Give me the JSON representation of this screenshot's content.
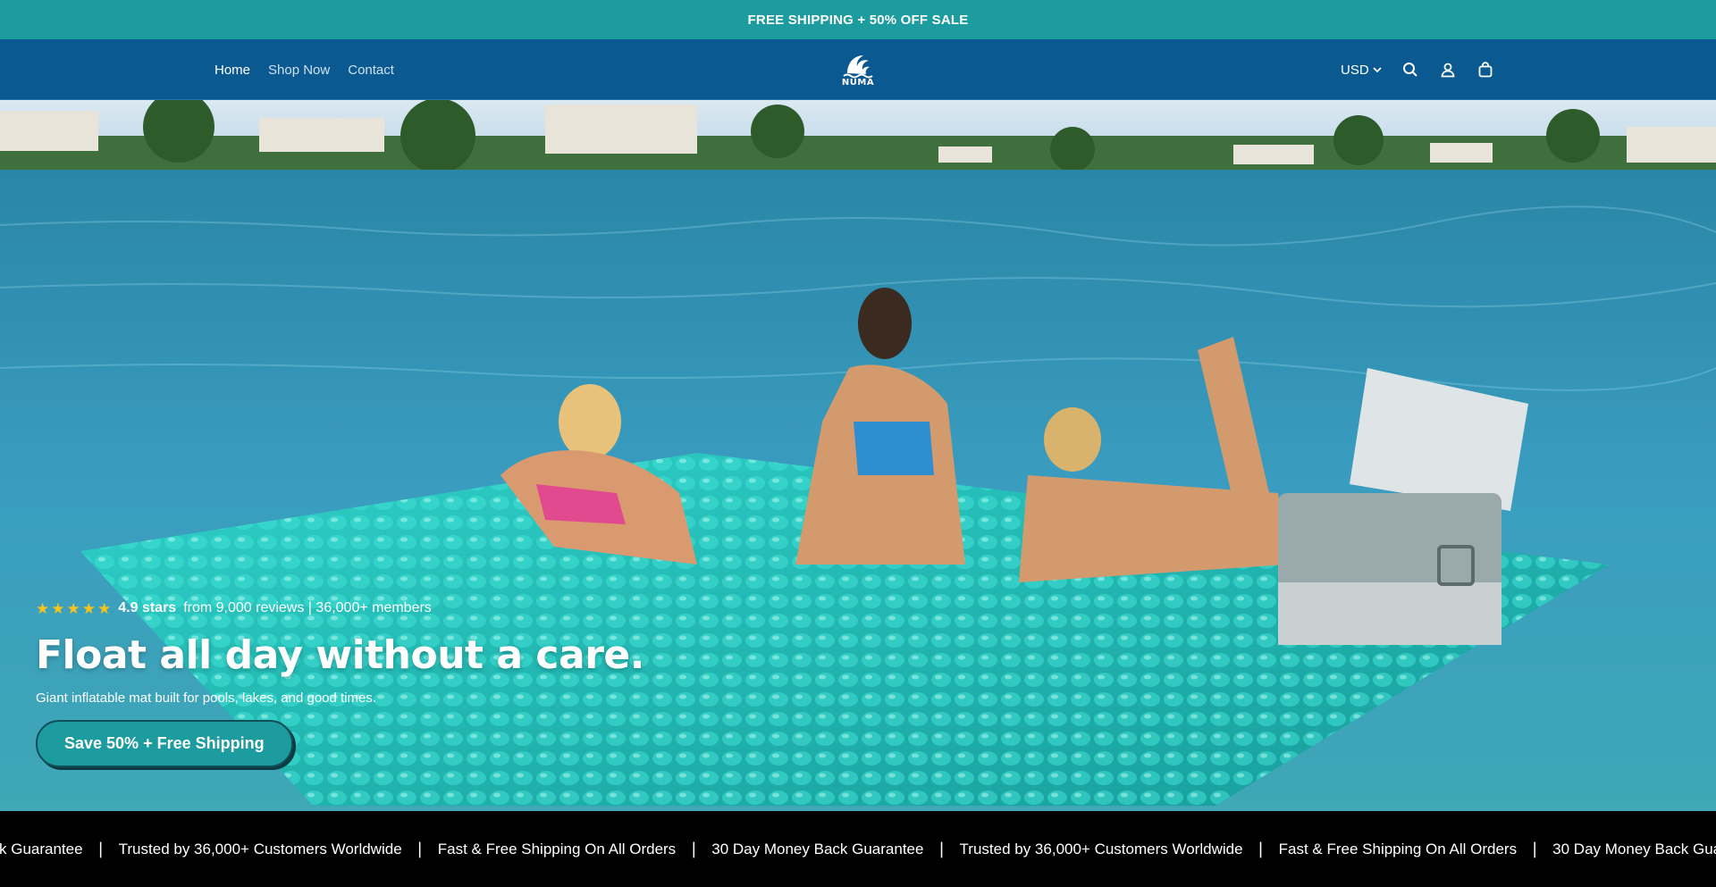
{
  "announcement": {
    "text": "FREE SHIPPING + 50% OFF SALE"
  },
  "header": {
    "nav": [
      {
        "label": "Home",
        "active": true
      },
      {
        "label": "Shop Now",
        "active": false
      },
      {
        "label": "Contact",
        "active": false
      }
    ],
    "logo_text": "NUMA",
    "currency": "USD",
    "icons": [
      "search-icon",
      "account-icon",
      "cart-icon"
    ]
  },
  "hero": {
    "rating_score": "4.9 stars",
    "rating_text": "from 9,000 reviews | 36,000+ members",
    "star_count": 5,
    "headline": "Float all day without a care.",
    "subtext": "Giant inflatable mat built for pools, lakes, and good times.",
    "cta_label": "Save 50% + Free Shipping"
  },
  "ticker": {
    "items": [
      "k Guarantee",
      "Trusted by 36,000+ Customers Worldwide",
      "Fast & Free Shipping On All Orders",
      "30 Day Money Back Guarantee",
      "Trusted by 36,000+ Customers Worldwide",
      "Fast & Free Shipping On All Orders",
      "30 Day Money Back Guarantee"
    ],
    "separator": "|"
  },
  "colors": {
    "announcement_bg": "#1d9c9f",
    "header_bg": "#0b5991",
    "cta_bg": "#1d9c9f",
    "star": "#f7c31c",
    "ticker_bg": "#000000"
  }
}
